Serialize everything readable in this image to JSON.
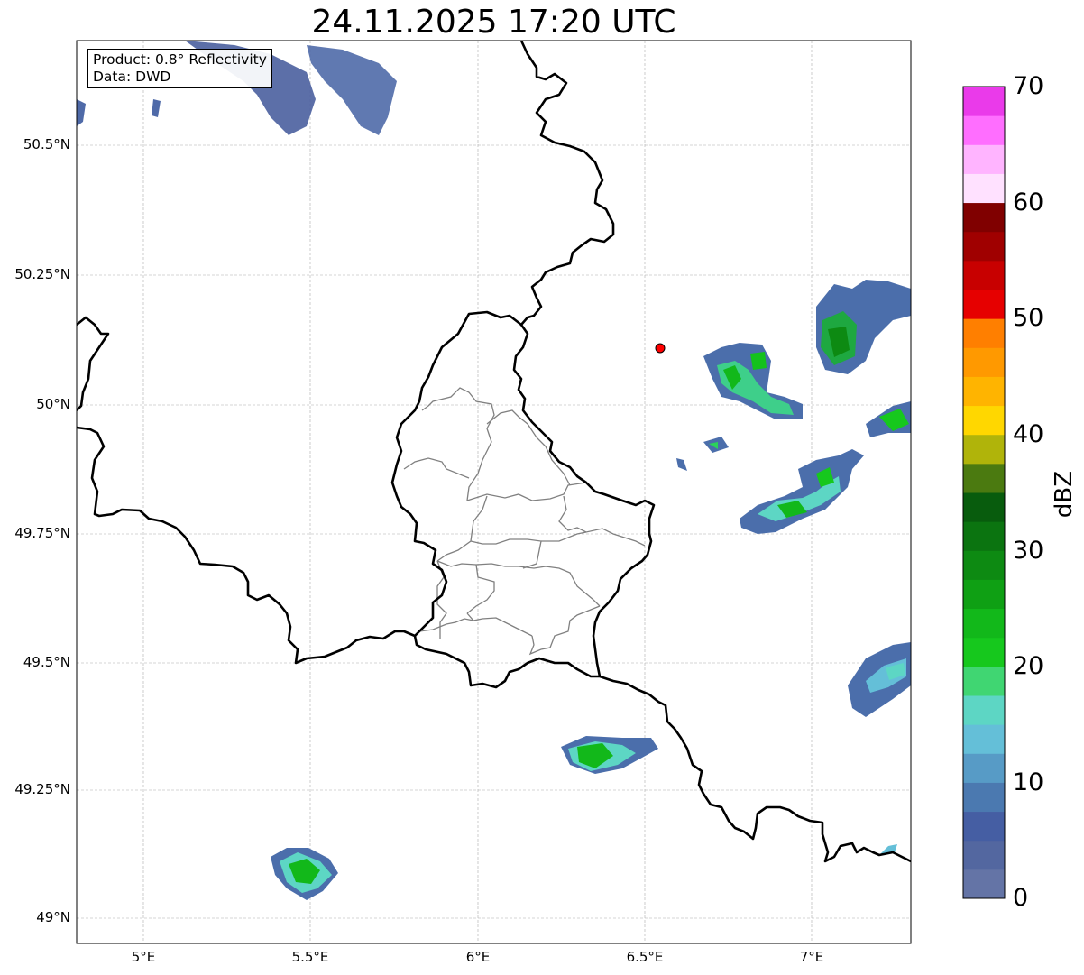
{
  "title": "24.11.2025 17:20 UTC",
  "info": {
    "product": "Product: 0.8° Reflectivity",
    "data": "Data: DWD"
  },
  "map": {
    "extent_lon": [
      4.8,
      7.3
    ],
    "extent_lat": [
      48.95,
      50.7
    ],
    "radar_site": {
      "lon": 6.55,
      "lat": 50.11,
      "color": "#ff0000"
    },
    "country_border_color": "#000000",
    "canton_border_color": "#808080",
    "gridlines": true
  },
  "axes": {
    "lat_ticks": [
      "50.5°N",
      "50.25°N",
      "50°N",
      "49.75°N",
      "49.5°N",
      "49.25°N",
      "49°N"
    ],
    "lon_ticks": [
      "5°E",
      "5.5°E",
      "6°E",
      "6.5°E",
      "7°E"
    ]
  },
  "colorbar": {
    "label": "dBZ",
    "min": 0,
    "max": 70,
    "ticks": [
      "0",
      "10",
      "20",
      "30",
      "40",
      "50",
      "60",
      "70"
    ],
    "colors": [
      "#6474a6",
      "#5367a0",
      "#455ea3",
      "#4b79b0",
      "#579bc6",
      "#64bfd8",
      "#5dd6c4",
      "#40d672",
      "#16c81d",
      "#12b81a",
      "#0fa014",
      "#0d8a12",
      "#0b7410",
      "#085c0d",
      "#4b7a10",
      "#b0b40a",
      "#ffd700",
      "#ffb400",
      "#ff9900",
      "#ff7f00",
      "#e60000",
      "#c80000",
      "#a00000",
      "#800000",
      "#ffe1ff",
      "#ffb4ff",
      "#ff6eff",
      "#ea3aea"
    ]
  },
  "echoes": [
    {
      "lon": 5.75,
      "lat": 50.6,
      "dbz": 5
    },
    {
      "lon": 6.79,
      "lat": 50.03,
      "dbz": 22
    },
    {
      "lon": 7.07,
      "lat": 50.13,
      "dbz": 24
    },
    {
      "lon": 6.95,
      "lat": 49.82,
      "dbz": 22
    },
    {
      "lon": 7.2,
      "lat": 49.48,
      "dbz": 14
    },
    {
      "lon": 6.37,
      "lat": 49.32,
      "dbz": 22
    },
    {
      "lon": 5.49,
      "lat": 49.1,
      "dbz": 24
    }
  ]
}
